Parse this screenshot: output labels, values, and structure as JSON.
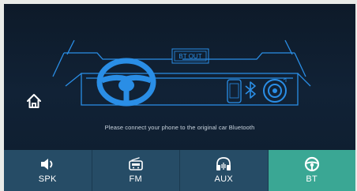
{
  "bt_out_label": "BT OUT",
  "message": "Please connect your phone to the original car Bluetooth",
  "home_icon": "home-icon",
  "tabs": [
    {
      "label": "SPK",
      "icon": "speaker-icon",
      "active": false
    },
    {
      "label": "FM",
      "icon": "radio-icon",
      "active": false
    },
    {
      "label": "AUX",
      "icon": "headphones-icon",
      "active": false
    },
    {
      "label": "BT",
      "icon": "steering-wheel-icon",
      "active": true
    }
  ],
  "colors": {
    "background": "#0f1d2e",
    "line_blue": "#2a8ee6",
    "tab_inactive": "#264c66",
    "tab_active": "#3aa794"
  }
}
